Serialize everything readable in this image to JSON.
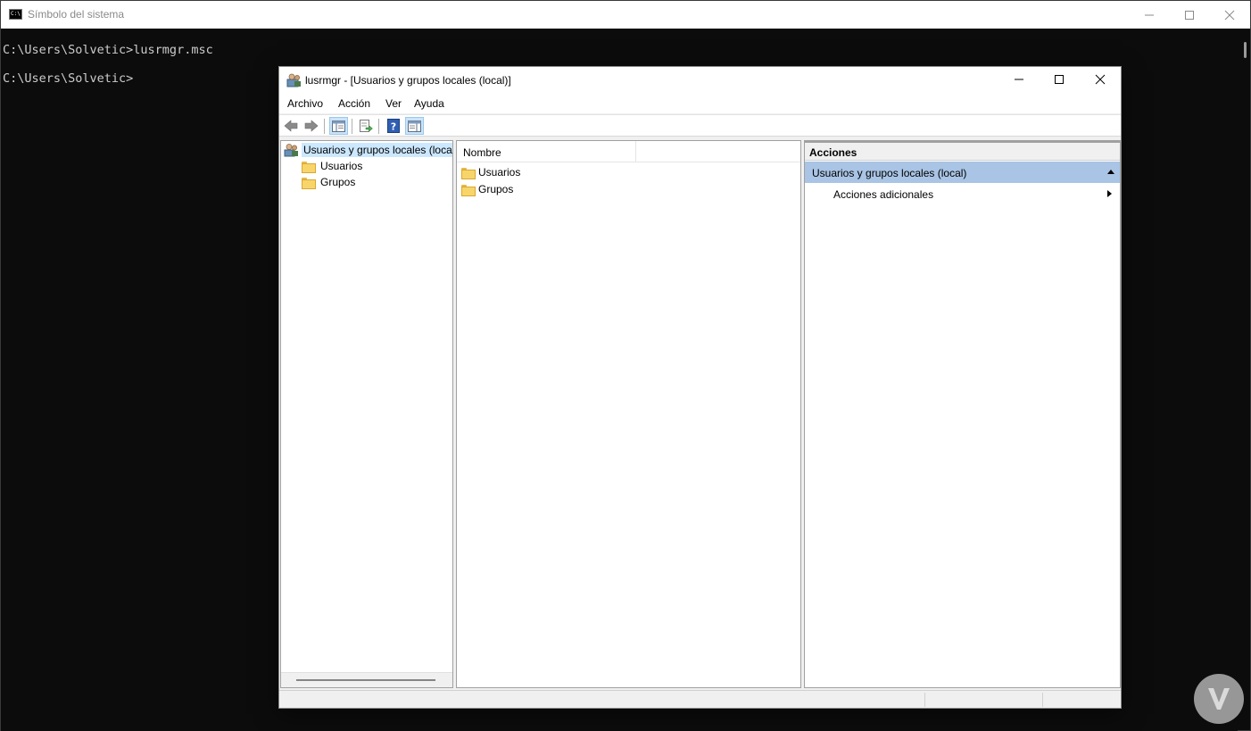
{
  "console": {
    "title": "Símbolo del sistema",
    "lines": [
      "C:\\Users\\Solvetic>lusrmgr.msc",
      "C:\\Users\\Solvetic>"
    ]
  },
  "mmc": {
    "title": "lusrmgr - [Usuarios y grupos locales (local)]",
    "menu": [
      "Archivo",
      "Acción",
      "Ver",
      "Ayuda"
    ],
    "toolbar_icons": [
      "back-icon",
      "forward-icon",
      "show-hide-console-tree-icon",
      "export-list-icon",
      "help-icon",
      "show-hide-action-pane-icon"
    ],
    "tree": {
      "root": "Usuarios y grupos locales (local)",
      "children": [
        "Usuarios",
        "Grupos"
      ]
    },
    "list": {
      "column_header": "Nombre",
      "items": [
        "Usuarios",
        "Grupos"
      ]
    },
    "actions": {
      "header": "Acciones",
      "section": "Usuarios y grupos locales (local)",
      "item": "Acciones adicionales"
    }
  },
  "colors": {
    "console_bg": "#0c0c0c",
    "console_text": "#cccccc",
    "selection_bg": "#cce8ff",
    "actions_section_bg": "#a9c4e4"
  }
}
